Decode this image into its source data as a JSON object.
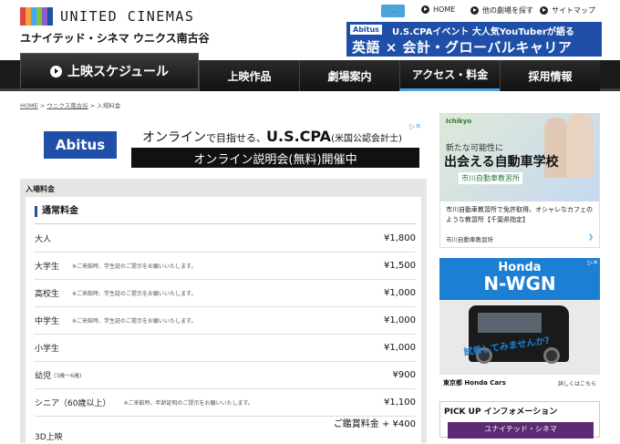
{
  "header": {
    "logo_text": "UNITED CINEMAS",
    "theater_name": "ユナイテッド・シネマ ウニクス南古谷",
    "utility_links": [
      "HOME",
      "他の劇場を探す",
      "サイトマップ"
    ],
    "banner": {
      "brand": "Abitus",
      "line1": "U.S.CPAイベント 大人気YouTuberが語る",
      "line2": "英語 × 会計・グローバルキャリア"
    }
  },
  "nav": {
    "schedule": "上映スケジュール",
    "items": [
      "上映作品",
      "劇場案内",
      "アクセス・料金",
      "採用情報"
    ]
  },
  "breadcrumb": {
    "home": "HOME",
    "theater": "ウニクス南古谷",
    "current": "入場料金",
    "sep": ">"
  },
  "ad_main": {
    "logo": "Abitus",
    "line1_a": "オンライン",
    "line1_b": "で目指せる、",
    "line1_c": "U.S.CPA",
    "line1_d": "(米国公認会計士)",
    "line2": "オンライン説明会(無料)開催中"
  },
  "prices": {
    "panel_title": "入場料金",
    "section_title": "通常料金",
    "rows": [
      {
        "label": "大人",
        "note": "",
        "price": "¥1,800"
      },
      {
        "label": "大学生",
        "note": "※ご来館時、学生証のご提示をお願いいたします。",
        "price": "¥1,500"
      },
      {
        "label": "高校生",
        "note": "※ご来館時、学生証のご提示をお願いいたします。",
        "price": "¥1,000"
      },
      {
        "label": "中学生",
        "note": "※ご来館時、学生証のご提示をお願いいたします。",
        "price": "¥1,000"
      },
      {
        "label": "小学生",
        "note": "",
        "price": "¥1,000"
      },
      {
        "label": "幼児",
        "note": "(3歳〜6歳)",
        "price": "¥900"
      },
      {
        "label": "シニア（60歳以上）",
        "note": "※ご来館時、年齢証明のご提示をお願いいたします。",
        "price": "¥1,100"
      },
      {
        "label": "3D上映",
        "note": "",
        "price": "ご鑑賞料金 + ¥400"
      }
    ]
  },
  "side_ad1": {
    "brand": "Ichikyo",
    "t1": "新たな可能性に",
    "t2": "出会える自動車学校",
    "t3": "市川自動車教習所",
    "desc": "市川自動車教習所で免許取得。オシャレなカフェのような教習所【千葉県指定】",
    "source": "市川自動車教習所"
  },
  "side_ad2": {
    "h1": "Honda",
    "h2": "N-WGN",
    "cta": "試乗してみませんか?",
    "bottom_left": "東京都 Honda Cars",
    "bottom_right": "詳しくはこちら"
  },
  "pickup": {
    "title": "PICK UP インフォメーション",
    "banner": "ユナイテッド・シネマ"
  },
  "colors": {
    "accent": "#4aa3df",
    "brand_blue": "#1f4fa8",
    "nav_bg": "#1b1b1b"
  }
}
